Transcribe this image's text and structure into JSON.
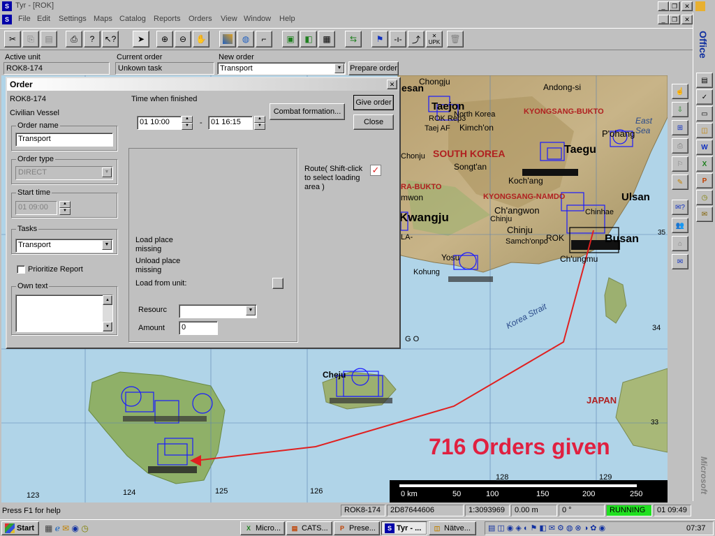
{
  "app": {
    "title": "Tyr - [ROK]",
    "icon": "S"
  },
  "menu": [
    "File",
    "Edit",
    "Settings",
    "Maps",
    "Catalog",
    "Reports",
    "Orders",
    "View",
    "Window",
    "Help"
  ],
  "toolbar": {
    "upk_label": "UPK"
  },
  "info": {
    "active_unit_label": "Active unit",
    "active_unit_value": "ROK8-174",
    "current_order_label": "Current order",
    "current_order_value": "Unkown task",
    "new_order_label": "New order",
    "new_order_value": "Transport",
    "prepare_order": "Prepare order"
  },
  "dialog": {
    "title": "Order",
    "unit": "ROK8-174",
    "vessel": "Civilian Vessel",
    "time_when_finished": "Time when finished",
    "time_from": "01 10:00",
    "time_sep": "-",
    "time_to": "01 16:15",
    "combat_formation": "Combat formation...",
    "give_order": "Give order",
    "close": "Close",
    "order_name_label": "Order name",
    "order_name_value": "Transport",
    "order_type_label": "Order type",
    "order_type_value": "DIRECT",
    "start_time_label": "Start time",
    "start_time_value": "01 09:00",
    "tasks_label": "Tasks",
    "tasks_value": "Transport",
    "prioritize_report": "Prioritize Report",
    "own_text_label": "Own text",
    "route_label": "Route( Shift-click to select loading area )",
    "load_place": "Load place missing",
    "unload_place": "Unload place missing",
    "load_from_unit": "Load from unit:",
    "resource_label": "Resourc",
    "amount_label": "Amount",
    "amount_value": "0"
  },
  "map": {
    "labels": {
      "seoul_area": "Chongju",
      "taejon": "Taejon",
      "andong": "Andong-si",
      "kyongsang_bukto": "KYONGSANG-BUKTO",
      "east_sea": "East Sea",
      "south_korea": "SOUTH KOREA",
      "songtan": "Songt'an",
      "taegu": "Taegu",
      "pohang": "P'ohang",
      "kochang": "Koch'ang",
      "ulsan": "Ulsan",
      "kwangju": "Kwangju",
      "kyongsang_namdo": "KYONGSANG-NAMDO",
      "changwon": "Ch'angwon",
      "chinju": "Chinju",
      "busan": "Busan",
      "samchonpo": "Samch'onpo",
      "chungmu": "Ch'ungmu",
      "yosu": "Yosu",
      "kohung": "Kohung",
      "korea_strait": "Korea Strait",
      "japan": "JAPAN",
      "cheju": "Cheju",
      "taej_af": "Taej AF",
      "rok_rep3": "ROK Rep3",
      "north_korea": "North Korea",
      "kimchon": "Kimch'on",
      "chonju": "Chonju",
      "ra_bukto": "RA-BUKTO",
      "wonju": "mwon",
      "la": "LA-",
      "chinhae": "Chinhae",
      "rok": "ROK",
      "go": "G O"
    },
    "lat_labels": [
      "35",
      "34",
      "33"
    ],
    "lon_labels": [
      "123",
      "124",
      "125",
      "126",
      "128",
      "129"
    ],
    "overlay_text": "716 Orders given",
    "scale_labels": [
      "0 km",
      "50",
      "100",
      "150",
      "200",
      "250"
    ],
    "route_color": "#e02020",
    "unit_color": "#1a1aff"
  },
  "status": {
    "help": "Press F1 for help",
    "unit": "ROK8-174",
    "coord": "2D87644606",
    "scale": "1:3093969",
    "elev": "0.00 m",
    "heading": "0 °",
    "running": "RUNNING",
    "time": "01 09:49"
  },
  "taskbar": {
    "start": "Start",
    "tasks": [
      "Micro...",
      "CATS...",
      "Prese...",
      "Tyr - ...",
      "Nätve..."
    ],
    "clock": "07:37"
  },
  "office": {
    "label": "Office",
    "brand": "Microsoft"
  }
}
